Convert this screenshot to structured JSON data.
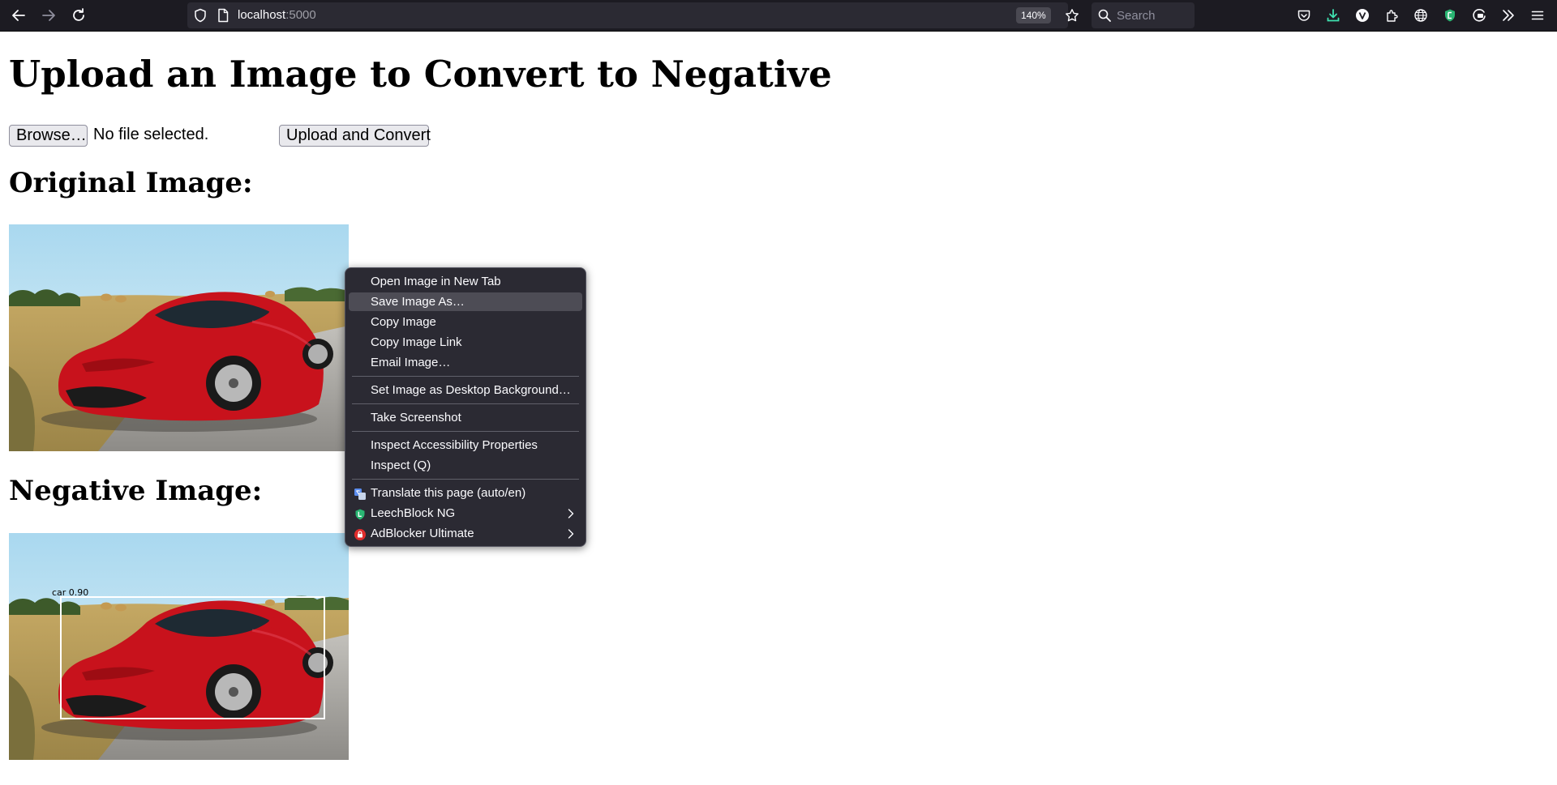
{
  "browser": {
    "url_host": "localhost",
    "url_port": ":5000",
    "zoom": "140%",
    "search_placeholder": "Search"
  },
  "page": {
    "title": "Upload an Image to Convert to Negative",
    "browse_button": "Browse…",
    "file_status": "No file selected.",
    "upload_button": "Upload and Convert",
    "original_heading": "Original Image:",
    "negative_heading": "Negative Image:",
    "detection_label": "car 0.90"
  },
  "context_menu": {
    "items": [
      {
        "label": "Open Image in New Tab"
      },
      {
        "label": "Save Image As…"
      },
      {
        "label": "Copy Image"
      },
      {
        "label": "Copy Image Link"
      },
      {
        "label": "Email Image…"
      },
      {
        "label": "Set Image as Desktop Background…"
      },
      {
        "label": "Take Screenshot"
      },
      {
        "label": "Inspect Accessibility Properties"
      },
      {
        "label": "Inspect (Q)"
      },
      {
        "label": "Translate this page (auto/en)"
      },
      {
        "label": "LeechBlock NG"
      },
      {
        "label": "AdBlocker Ultimate"
      }
    ]
  },
  "colors": {
    "toolbar_bg": "#1c1b22",
    "urlbar_bg": "#2b2a33",
    "menu_bg": "#2b2a33",
    "menu_highlight": "#4d4c55",
    "car_red": "#c8121c",
    "download_accent": "#3fe1b0"
  },
  "icons": {
    "back": "back-arrow-icon",
    "forward": "forward-arrow-icon",
    "reload": "reload-icon",
    "shield": "tracking-shield-icon",
    "page": "page-info-icon",
    "bookmark": "star-icon",
    "search": "search-icon",
    "pocket": "pocket-icon",
    "download": "download-icon",
    "vpn": "vpn-icon",
    "extensions": "extensions-icon",
    "translate": "translate-icon",
    "leechblock": "leechblock-icon",
    "adblocker": "adblocker-icon",
    "overflow": "chevron-double-icon",
    "menu": "hamburger-menu-icon"
  }
}
